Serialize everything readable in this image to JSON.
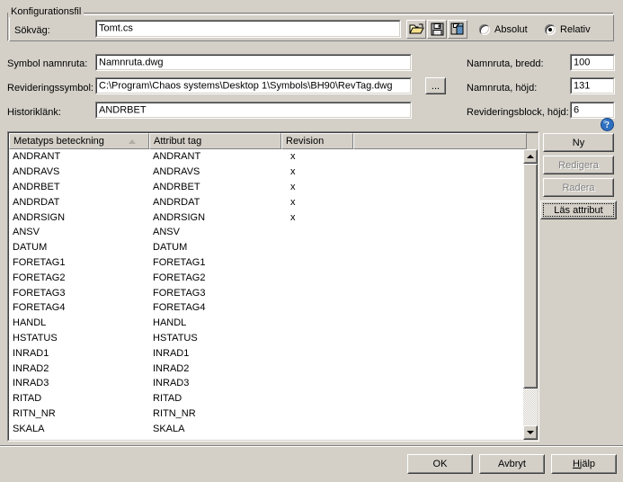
{
  "groupbox": {
    "title": "Konfigurationsfil"
  },
  "fields": {
    "sokvag_label": "Sökväg:",
    "sokvag_value": "Tomt.cs",
    "symbol_namnruta_label": "Symbol namnruta:",
    "symbol_namnruta_value": "Namnruta.dwg",
    "revideringssymbol_label": "Revideringssymbol:",
    "revideringssymbol_value": "C:\\Program\\Chaos systems\\Desktop 1\\Symbols\\BH90\\RevTag.dwg",
    "historiklank_label": "Historiklänk:",
    "historiklank_value": "ANDRBET",
    "browse_button": "...",
    "namnruta_bredd_label": "Namnruta, bredd:",
    "namnruta_bredd_value": "100",
    "namnruta_hojd_label": "Namnruta, höjd:",
    "namnruta_hojd_value": "131",
    "revideringsblock_hojd_label": "Revideringsblock, höjd:",
    "revideringsblock_hojd_value": "6"
  },
  "toolbar": {
    "open_icon": "open-folder-icon",
    "save_icon": "floppy-save-icon",
    "saveas_icon": "save-as-icon"
  },
  "pathmode": {
    "absolut_label": "Absolut",
    "relativ_label": "Relativ",
    "selected": "Relativ"
  },
  "help": {
    "icon": "help-question-icon"
  },
  "list": {
    "columns": [
      {
        "label": "Metatyps beteckning",
        "width": 156,
        "sorted": "asc"
      },
      {
        "label": "Attribut tag",
        "width": 147,
        "sorted": ""
      },
      {
        "label": "Revision",
        "width": 80,
        "sorted": ""
      },
      {
        "label": "",
        "width": 193,
        "sorted": ""
      }
    ],
    "rows": [
      {
        "metatyp": "ANDRANT",
        "tag": "ANDRANT",
        "revision": "x"
      },
      {
        "metatyp": "ANDRAVS",
        "tag": "ANDRAVS",
        "revision": "x"
      },
      {
        "metatyp": "ANDRBET",
        "tag": "ANDRBET",
        "revision": "x"
      },
      {
        "metatyp": "ANDRDAT",
        "tag": "ANDRDAT",
        "revision": "x"
      },
      {
        "metatyp": "ANDRSIGN",
        "tag": "ANDRSIGN",
        "revision": "x"
      },
      {
        "metatyp": "ANSV",
        "tag": "ANSV",
        "revision": ""
      },
      {
        "metatyp": "DATUM",
        "tag": "DATUM",
        "revision": ""
      },
      {
        "metatyp": "FORETAG1",
        "tag": "FORETAG1",
        "revision": ""
      },
      {
        "metatyp": "FORETAG2",
        "tag": "FORETAG2",
        "revision": ""
      },
      {
        "metatyp": "FORETAG3",
        "tag": "FORETAG3",
        "revision": ""
      },
      {
        "metatyp": "FORETAG4",
        "tag": "FORETAG4",
        "revision": ""
      },
      {
        "metatyp": "HANDL",
        "tag": "HANDL",
        "revision": ""
      },
      {
        "metatyp": "HSTATUS",
        "tag": "HSTATUS",
        "revision": ""
      },
      {
        "metatyp": "INRAD1",
        "tag": "INRAD1",
        "revision": ""
      },
      {
        "metatyp": "INRAD2",
        "tag": "INRAD2",
        "revision": ""
      },
      {
        "metatyp": "INRAD3",
        "tag": "INRAD3",
        "revision": ""
      },
      {
        "metatyp": "RITAD",
        "tag": "RITAD",
        "revision": ""
      },
      {
        "metatyp": "RITN_NR",
        "tag": "RITN_NR",
        "revision": ""
      },
      {
        "metatyp": "SKALA",
        "tag": "SKALA",
        "revision": ""
      }
    ]
  },
  "sidebuttons": {
    "ny": "Ny",
    "redigera": "Redigera",
    "radera": "Radera",
    "las_attribut": "Läs attribut"
  },
  "bottombuttons": {
    "ok": "OK",
    "avbryt": "Avbryt",
    "hjalp_accel": "H",
    "hjalp_rest": "jälp"
  },
  "colors": {
    "dialog_face": "#d4d0c8",
    "field_bg": "#ffffff",
    "shadow": "#808080",
    "dark_shadow": "#404040",
    "highlight": "#ffffff",
    "disabled_text": "#808080",
    "help_blue": "#2f6fc0"
  }
}
